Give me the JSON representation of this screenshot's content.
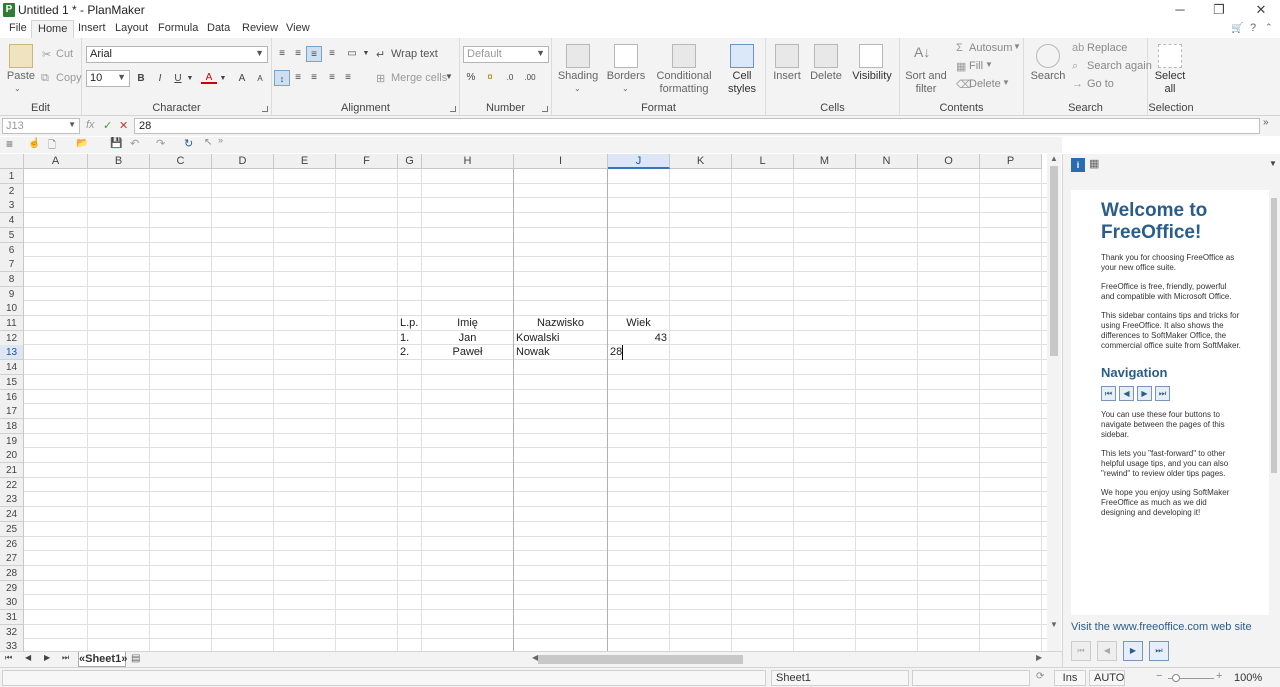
{
  "window": {
    "title": "Untitled 1 * - PlanMaker",
    "app_icon": "P",
    "minimize": "─",
    "maximize": "❐",
    "close": "✕"
  },
  "menu": {
    "items": [
      "File",
      "Home",
      "Insert",
      "Layout",
      "Formula",
      "Data",
      "Review",
      "View"
    ],
    "active": "Home",
    "help": "?"
  },
  "ribbon": {
    "edit": {
      "label": "Edit",
      "paste": "Paste",
      "cut": "Cut",
      "copy": "Copy"
    },
    "character": {
      "label": "Character",
      "font": "Arial",
      "size": "10",
      "bold": "B",
      "italic": "I",
      "underline": "U",
      "fontcolor": "A",
      "grow": "A",
      "shrink": "A"
    },
    "alignment": {
      "label": "Alignment",
      "wrap": "Wrap text",
      "merge": "Merge cells"
    },
    "number": {
      "label": "Number",
      "format": "Default",
      "percent": "%"
    },
    "format": {
      "label": "Format",
      "shading": "Shading",
      "borders": "Borders",
      "conditional1": "Conditional",
      "conditional2": "formatting",
      "cellstyles1": "Cell",
      "cellstyles2": "styles"
    },
    "cells": {
      "label": "Cells",
      "insert": "Insert",
      "delete": "Delete",
      "visibility": "Visibility"
    },
    "contents": {
      "label": "Contents",
      "sort1": "Sort and",
      "sort2": "filter",
      "autosum": "Autosum",
      "fill": "Fill",
      "delete": "Delete"
    },
    "search": {
      "label": "Search",
      "search": "Search",
      "replace": "Replace",
      "again": "Search again",
      "goto": "Go to"
    },
    "selection": {
      "label": "Selection",
      "select1": "Select",
      "select2": "all"
    }
  },
  "formula_bar": {
    "cell_ref": "J13",
    "fx": "fx",
    "value": "28"
  },
  "grid": {
    "columns": [
      "A",
      "B",
      "C",
      "D",
      "E",
      "F",
      "G",
      "H",
      "I",
      "J",
      "K",
      "L",
      "M",
      "N",
      "O",
      "P"
    ],
    "selected_column": "J",
    "rows": [
      "1",
      "2",
      "3",
      "4",
      "5",
      "6",
      "7",
      "8",
      "9",
      "10",
      "11",
      "12",
      "13",
      "14",
      "15",
      "16",
      "17",
      "18",
      "19",
      "20",
      "21",
      "22",
      "23",
      "24",
      "25",
      "26",
      "27",
      "28",
      "29",
      "30",
      "31",
      "32",
      "33"
    ],
    "selected_row": "13",
    "cells": {
      "G11": "L.p.",
      "H11": "Imię",
      "I11": "Nazwisko",
      "J11": "Wiek",
      "G12": "1.",
      "H12": "Jan",
      "I12": "Kowalski",
      "J12": "43",
      "G13": "2.",
      "H13": "Paweł",
      "I13": "Nowak",
      "J13": "28"
    }
  },
  "sheet_tabs": {
    "active": "«Sheet1»"
  },
  "status": {
    "sheet": "Sheet1",
    "mode": "Ins",
    "calc": "AUTO",
    "zoom": "100%"
  },
  "sidebar": {
    "title": "Welcome to FreeOffice!",
    "p1": "Thank you for choosing FreeOffice as your new office suite.",
    "p2": "FreeOffice is free, friendly, powerful and compatible with Microsoft Office.",
    "p3": "This sidebar contains tips and tricks for using FreeOffice. It also shows the differences to SoftMaker Office, the commercial office suite from SoftMaker.",
    "nav_title": "Navigation",
    "p4": "You can use these four buttons to navigate between the pages of this sidebar.",
    "p5": "This lets you \"fast-forward\" to other helpful usage tips, and you can also \"rewind\" to review older tips pages.",
    "p6": "We hope you enjoy using SoftMaker FreeOffice as much as we did designing and developing it!",
    "link": "Visit the www.freeoffice.com web site"
  }
}
